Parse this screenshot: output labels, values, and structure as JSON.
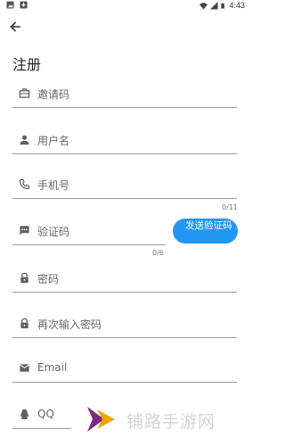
{
  "status_bar": {
    "time": "4:43",
    "icons": [
      "gallery-icon",
      "download-icon",
      "wifi-icon",
      "signal-icon",
      "battery-icon"
    ]
  },
  "header": {
    "back_icon": "arrow-back-icon",
    "title": "注册"
  },
  "form": {
    "invite_code": {
      "label": "邀请码",
      "icon": "id-card-icon"
    },
    "username": {
      "label": "用户名",
      "icon": "person-icon"
    },
    "phone": {
      "label": "手机号",
      "icon": "phone-icon",
      "counter": "0/11"
    },
    "verification_code": {
      "label": "验证码",
      "icon": "sms-icon",
      "counter": "0/6"
    },
    "send_code_button": {
      "label": "发送验证码"
    },
    "password": {
      "label": "密码",
      "icon": "lock-icon"
    },
    "confirm_password": {
      "label": "再次输入密码",
      "icon": "lock-icon"
    },
    "email": {
      "label": "Email",
      "icon": "mail-icon"
    },
    "qq": {
      "label": "QQ",
      "icon": "qq-penguin-icon"
    }
  },
  "watermark": {
    "text": "铺路手游网"
  },
  "colors": {
    "accent": "#2196f3",
    "underline": "#9a9a9a",
    "icon": "#606060",
    "watermark_logo_dark": "#7b2a7f",
    "watermark_logo_light": "#f0a400"
  }
}
